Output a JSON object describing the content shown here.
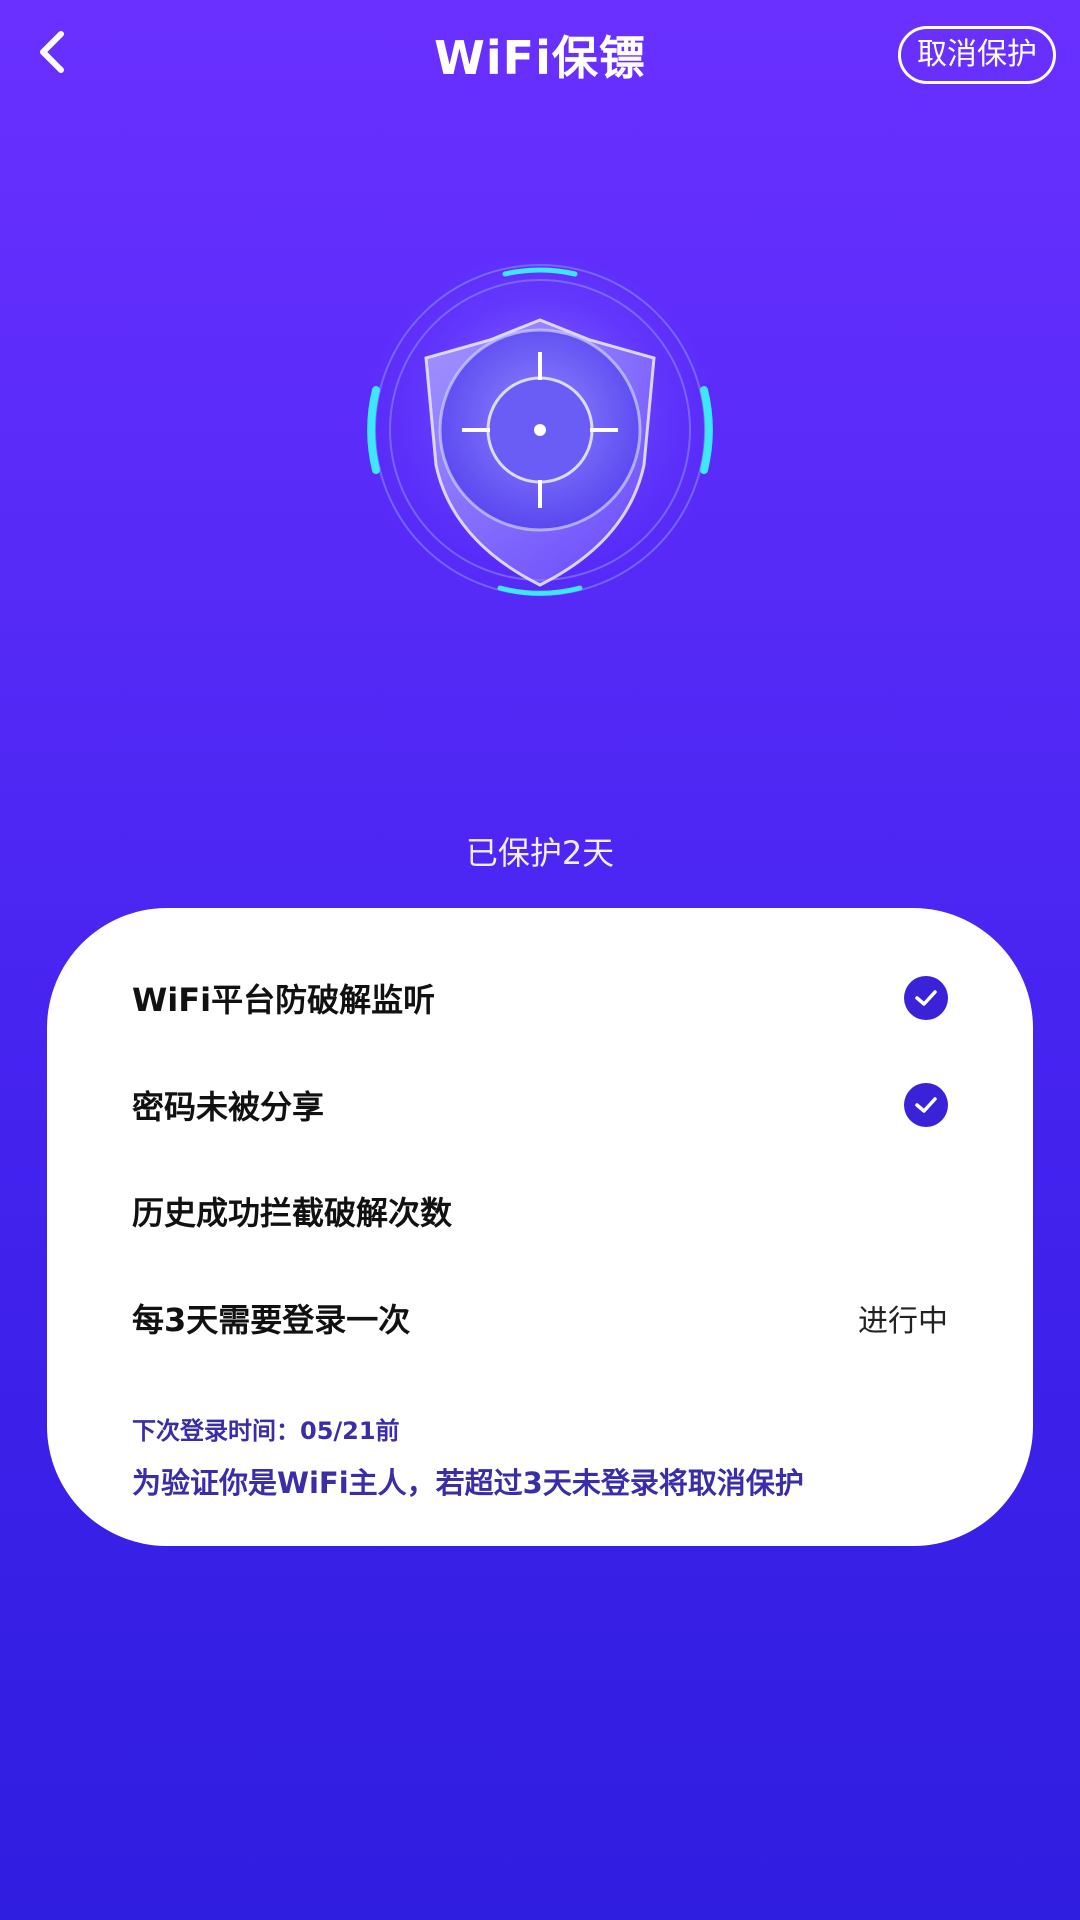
{
  "header": {
    "title": "WiFi保镖",
    "cancel_label": "取消保护"
  },
  "status": {
    "protected_text": "已保护2天"
  },
  "card": {
    "items": [
      {
        "label": "WiFi平台防破解监听",
        "state": "checked"
      },
      {
        "label": "密码未被分享",
        "state": "checked"
      },
      {
        "label": "历史成功拦截破解次数",
        "value": ""
      },
      {
        "label": "每3天需要登录一次",
        "value": "进行中"
      }
    ],
    "next_login": "下次登录时间：05/21前",
    "notice": "为验证你是WiFi主人，若超过3天未登录将取消保护"
  },
  "icons": {
    "back": "chevron-left-icon",
    "check": "check-circle-icon",
    "hero": "shield-crosshair-icon"
  },
  "colors": {
    "background_top": "#6a30ff",
    "background_bottom": "#2f1de0",
    "check_fill": "#3a22d9",
    "notice_text": "#3a2ea8",
    "accent_cyan": "#3ee6ff"
  }
}
